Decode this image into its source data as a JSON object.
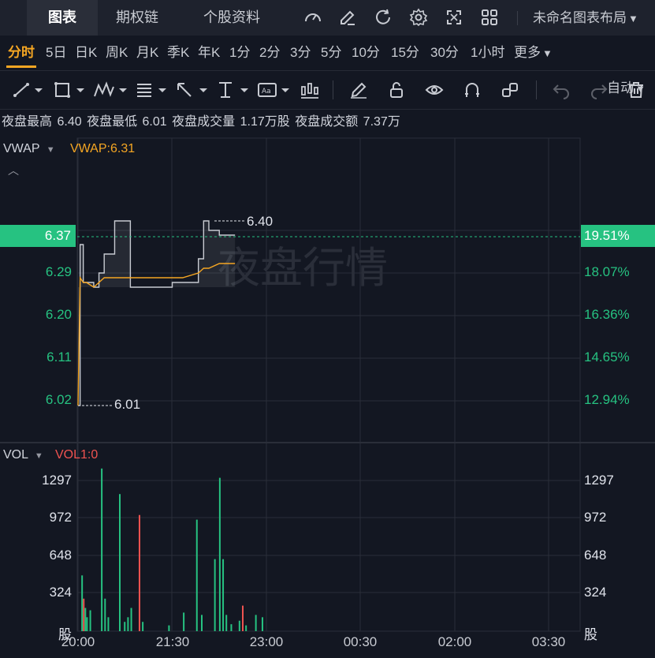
{
  "top_tabs": [
    {
      "label": "图表",
      "active": true
    },
    {
      "label": "期权链",
      "active": false
    },
    {
      "label": "个股资料",
      "active": false
    }
  ],
  "toolbar_icons": [
    "speedometer-icon",
    "edit-icon",
    "refresh-icon",
    "settings-icon",
    "fullscreen-icon",
    "grid-layout-icon"
  ],
  "layout_label": "未命名图表布局",
  "periods": [
    "分时",
    "5日",
    "日K",
    "周K",
    "月K",
    "季K",
    "年K",
    "1分",
    "2分",
    "3分",
    "5分",
    "10分",
    "15分",
    "30分",
    "1小时",
    "更多"
  ],
  "active_period": "分时",
  "scale_mode": "自动",
  "drawing_tools": [
    "line-tool-icon",
    "rectangle-tool-icon",
    "pattern-tool-icon",
    "fib-tool-icon",
    "arrow-tool-icon",
    "measure-tool-icon",
    "text-tool-icon",
    "candle-tool-icon",
    "pencil-icon",
    "unlock-icon",
    "eye-icon",
    "magnet-icon",
    "link-icon",
    "undo-icon",
    "redo-icon",
    "trash-icon"
  ],
  "stats": {
    "high_label": "夜盘最高",
    "high_value": "6.40",
    "low_label": "夜盘最低",
    "low_value": "6.01",
    "vol_label": "夜盘成交量",
    "vol_value": "1.17万股",
    "amt_label": "夜盘成交额",
    "amt_value": "7.37万"
  },
  "vwap": {
    "label": "VWAP",
    "value_text": "VWAP:6.31"
  },
  "watermark": "夜盘行情",
  "price_axis_left": [
    "6.29",
    "6.20",
    "6.11",
    "6.02"
  ],
  "price_axis_right": [
    "18.07%",
    "16.36%",
    "14.65%",
    "12.94%"
  ],
  "current_price": {
    "left": "6.37",
    "right": "19.51%"
  },
  "high_marker": "6.40",
  "low_marker": "6.01",
  "volume": {
    "label": "VOL",
    "value_text": "VOL1:0",
    "axis": [
      "1297",
      "972",
      "648",
      "324",
      "股"
    ]
  },
  "time_axis": [
    "20:00",
    "21:30",
    "23:00",
    "00:30",
    "02:00",
    "03:30"
  ],
  "colors": {
    "up": "#26c281",
    "down": "#ef5350",
    "vwap": "#f5a623",
    "background": "#131722"
  },
  "chart_data": [
    {
      "type": "line",
      "x": [
        "20:00",
        "20:02",
        "20:05",
        "20:08",
        "20:15",
        "20:20",
        "20:25",
        "20:35",
        "20:40",
        "20:50",
        "21:00",
        "21:15",
        "21:30",
        "21:40",
        "21:55",
        "22:00",
        "22:05",
        "22:15",
        "22:20",
        "22:30"
      ],
      "series": [
        {
          "name": "",
          "values": [
            6.01,
            6.35,
            6.27,
            6.27,
            6.26,
            6.29,
            6.33,
            6.4,
            6.4,
            6.26,
            6.26,
            6.26,
            6.27,
            6.27,
            6.32,
            6.4,
            6.38,
            6.37,
            6.37,
            6.37
          ]
        },
        {
          "name": "VWAP",
          "values": [
            6.01,
            6.28,
            6.27,
            6.27,
            6.26,
            6.27,
            6.28,
            6.28,
            6.28,
            6.28,
            6.28,
            6.28,
            6.28,
            6.28,
            6.29,
            6.3,
            6.3,
            6.31,
            6.31,
            6.31
          ]
        }
      ],
      "ylim": [
        5.96,
        6.42
      ]
    },
    {
      "type": "bar",
      "series": [
        {
          "name": "VOL",
          "bars": [
            {
              "t": 2,
              "v": 480,
              "c": "up"
            },
            {
              "t": 3,
              "v": 280,
              "c": "down"
            },
            {
              "t": 4,
              "v": 200,
              "c": "up"
            },
            {
              "t": 5,
              "v": 120,
              "c": "up"
            },
            {
              "t": 7,
              "v": 180,
              "c": "up"
            },
            {
              "t": 14,
              "v": 1400,
              "c": "up"
            },
            {
              "t": 16,
              "v": 280,
              "c": "up"
            },
            {
              "t": 18,
              "v": 120,
              "c": "up"
            },
            {
              "t": 25,
              "v": 1180,
              "c": "up"
            },
            {
              "t": 28,
              "v": 80,
              "c": "up"
            },
            {
              "t": 30,
              "v": 120,
              "c": "up"
            },
            {
              "t": 32,
              "v": 200,
              "c": "up"
            },
            {
              "t": 37,
              "v": 1000,
              "c": "down"
            },
            {
              "t": 39,
              "v": 80,
              "c": "up"
            },
            {
              "t": 55,
              "v": 50,
              "c": "up"
            },
            {
              "t": 64,
              "v": 160,
              "c": "up"
            },
            {
              "t": 72,
              "v": 960,
              "c": "up"
            },
            {
              "t": 75,
              "v": 140,
              "c": "up"
            },
            {
              "t": 83,
              "v": 620,
              "c": "up"
            },
            {
              "t": 86,
              "v": 1320,
              "c": "up"
            },
            {
              "t": 88,
              "v": 620,
              "c": "up"
            },
            {
              "t": 90,
              "v": 140,
              "c": "up"
            },
            {
              "t": 93,
              "v": 60,
              "c": "up"
            },
            {
              "t": 98,
              "v": 90,
              "c": "up"
            },
            {
              "t": 100,
              "v": 220,
              "c": "down"
            },
            {
              "t": 102,
              "v": 50,
              "c": "up"
            },
            {
              "t": 108,
              "v": 140,
              "c": "up"
            },
            {
              "t": 112,
              "v": 120,
              "c": "up"
            }
          ]
        }
      ],
      "ylim": [
        0,
        1500
      ]
    }
  ]
}
